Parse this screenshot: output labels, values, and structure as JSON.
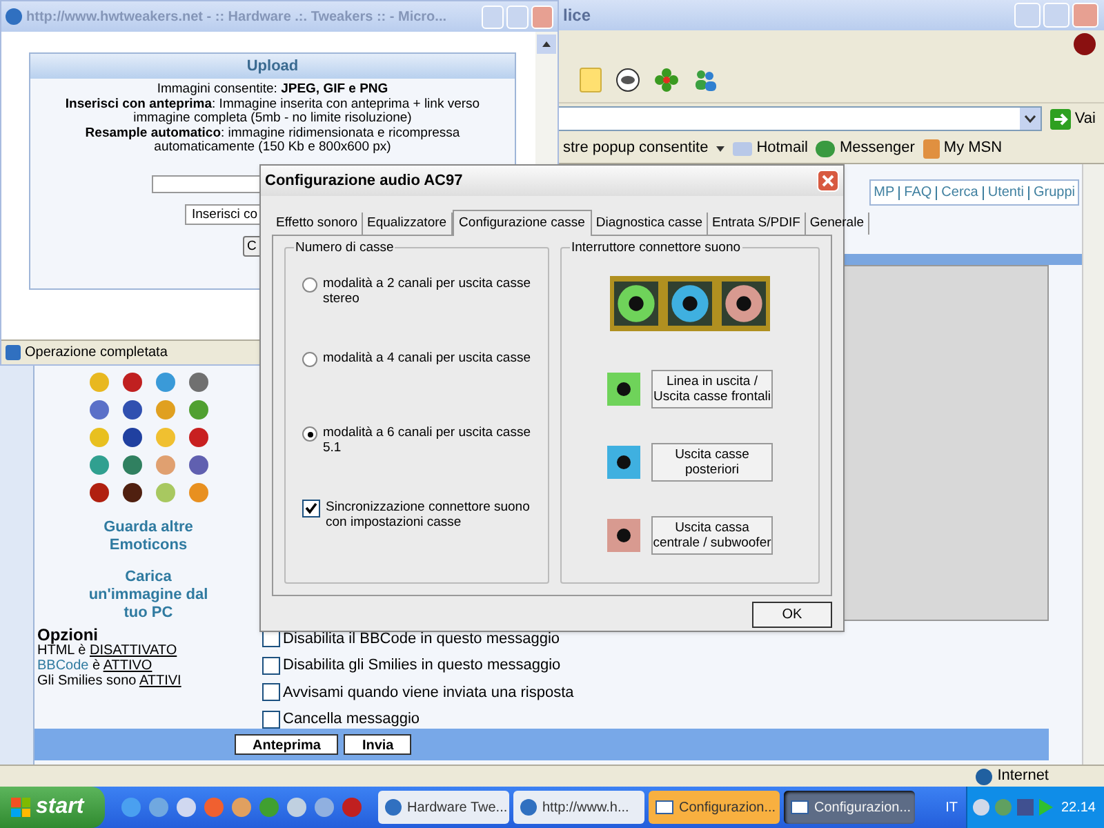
{
  "browser": {
    "title": "lice",
    "go_button": "Vai",
    "links_bar": {
      "popup_label": "stre popup consentite",
      "items": [
        "Hotmail",
        "Messenger",
        "My MSN"
      ]
    },
    "nav_links": [
      "MP",
      "FAQ",
      "Cerca",
      "Utenti",
      "Gruppi"
    ],
    "emoticon_links": [
      "Guarda altre Emoticons",
      "Carica un'immagine dal tuo PC"
    ],
    "options": {
      "title": "Opzioni",
      "lines": [
        {
          "subject": "HTML",
          "link": false,
          "verb": "è",
          "value": "DISATTIVATO"
        },
        {
          "subject": "BBCode",
          "link": true,
          "verb": "è",
          "value": "ATTIVO"
        },
        {
          "subject": "Gli Smilies",
          "link": false,
          "verb": "sono",
          "value": "ATTIVI"
        }
      ]
    },
    "checkboxes": [
      {
        "label": "Disabilita il BBCode in questo messaggio",
        "checked": false
      },
      {
        "label": "Disabilita gli Smilies in questo messaggio",
        "checked": false
      },
      {
        "label": "Avvisami quando viene inviata una risposta",
        "checked": false
      },
      {
        "label": "Cancella messaggio",
        "checked": false
      }
    ],
    "buttons": [
      "Anteprima",
      "Invia"
    ],
    "status_zone": "Internet"
  },
  "popup": {
    "title": "http://www.hwtweakers.net - :: Hardware .:. Tweakers :: - Micro...",
    "upload_title": "Upload",
    "lines": [
      "Immagini consentite: **JPEG, GIF e PNG**",
      "**Inserisci con anteprima**: Immagine inserita con anteprima + link verso immagine completa (5mb - no limite risoluzione)",
      "**Resample automatico**: immagine ridimensionata e ricompressa automaticamente (150 Kb e 800x600 px)"
    ],
    "select_value": "Inserisci co",
    "button_label": "C",
    "status": "Operazione completata"
  },
  "dialog": {
    "title": "Configurazione audio AC97",
    "tabs": [
      {
        "label": "Effetto sonoro",
        "selected": false
      },
      {
        "label": "Equalizzatore",
        "selected": false
      },
      {
        "label": "Configurazione casse",
        "selected": true
      },
      {
        "label": "Diagnostica casse",
        "selected": false
      },
      {
        "label": "Entrata S/PDIF",
        "selected": false
      },
      {
        "label": "Generale",
        "selected": false
      }
    ],
    "speakers": {
      "title": "Numero di casse",
      "radios": [
        {
          "label": "modalità a 2 canali per uscita casse stereo",
          "selected": false
        },
        {
          "label": "modalità a 4 canali per uscita casse",
          "selected": false
        },
        {
          "label": "modalità a 6 canali per uscita casse 5.1",
          "selected": true
        }
      ],
      "sync": {
        "label": "Sincronizzazione connettore suono con impostazioni casse",
        "checked": true
      }
    },
    "connectors": {
      "title": "Interruttore connettore suono",
      "jacks": [
        {
          "label": "Linea in uscita / Uscita casse frontali",
          "color": "#6fd35a"
        },
        {
          "label": "Uscita casse posteriori",
          "color": "#3fb0e0"
        },
        {
          "label": "Uscita cassa centrale / subwoofer",
          "color": "#d89a90"
        }
      ]
    },
    "ok_button": "OK"
  },
  "taskbar": {
    "start": "start",
    "tasks": [
      {
        "label": "Hardware Twe...",
        "kind": "browser",
        "selected": false,
        "flashing": false
      },
      {
        "label": "http://www.h...",
        "kind": "browser",
        "selected": false,
        "flashing": false
      },
      {
        "label": "Configurazion...",
        "kind": "window",
        "selected": false,
        "flashing": true
      },
      {
        "label": "Configurazion...",
        "kind": "window",
        "selected": true,
        "flashing": false
      }
    ],
    "language": "IT",
    "clock": "22.14"
  }
}
